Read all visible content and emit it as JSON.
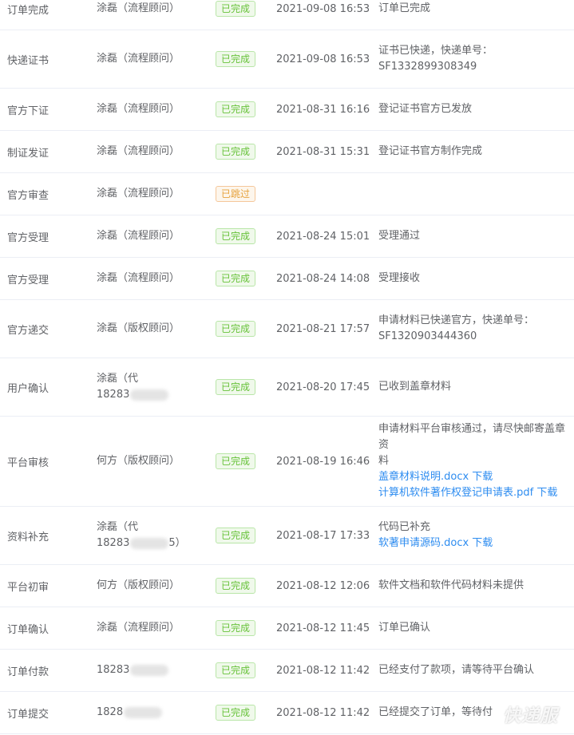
{
  "rows": [
    {
      "stage": "订单完成",
      "operator": "涂磊（流程顾问）",
      "status": "已完成",
      "time": "2021-09-08 16:53",
      "remark": [
        "订单已完成"
      ]
    },
    {
      "stage": "快递证书",
      "operator": "涂磊（流程顾问）",
      "status": "已完成",
      "time": "2021-09-08 16:53",
      "remark": [
        "证书已快递，快递单号：",
        "SF1332899308349"
      ]
    },
    {
      "stage": "官方下证",
      "operator": "涂磊（流程顾问）",
      "status": "已完成",
      "time": "2021-08-31 16:16",
      "remark": [
        "登记证书官方已发放"
      ]
    },
    {
      "stage": "制证发证",
      "operator": "涂磊（流程顾问）",
      "status": "已完成",
      "time": "2021-08-31 15:31",
      "remark": [
        "登记证书官方制作完成"
      ]
    },
    {
      "stage": "官方审查",
      "operator": "涂磊（流程顾问）",
      "status": "已跳过",
      "time": "",
      "remark": []
    },
    {
      "stage": "官方受理",
      "operator": "涂磊（流程顾问）",
      "status": "已完成",
      "time": "2021-08-24 15:01",
      "remark": [
        "受理通过"
      ]
    },
    {
      "stage": "官方受理",
      "operator": "涂磊（流程顾问）",
      "status": "已完成",
      "time": "2021-08-24 14:08",
      "remark": [
        "受理接收"
      ]
    },
    {
      "stage": "官方递交",
      "operator": "涂磊（版权顾问）",
      "status": "已完成",
      "time": "2021-08-21 17:57",
      "remark": [
        "申请材料已快递官方，快递单号：",
        "SF1320903444360"
      ]
    },
    {
      "stage": "用户确认",
      "operator": "涂磊（代",
      "operator2": "18283",
      "status": "已完成",
      "time": "2021-08-20 17:45",
      "remark": [
        "已收到盖章材料"
      ]
    },
    {
      "stage": "平台审核",
      "operator": "何方（版权顾问）",
      "status": "已完成",
      "time": "2021-08-19 16:46",
      "remark": [
        "申请材料平台审核通过，请尽快邮寄盖章资",
        "料"
      ],
      "links": [
        "盖章材料说明.docx 下载",
        "计算机软件著作权登记申请表.pdf 下载"
      ]
    },
    {
      "stage": "资料补充",
      "operator": "涂磊（代",
      "operator2": "18283",
      "operator2_tail": "5）",
      "status": "已完成",
      "time": "2021-08-17 17:33",
      "remark": [
        "代码已补充"
      ],
      "links": [
        "软著申请源码.docx 下载"
      ]
    },
    {
      "stage": "平台初审",
      "operator": "何方（版权顾问）",
      "status": "已完成",
      "time": "2021-08-12 12:06",
      "remark": [
        "软件文档和软件代码材料未提供"
      ]
    },
    {
      "stage": "订单确认",
      "operator": "涂磊（流程顾问）",
      "status": "已完成",
      "time": "2021-08-12 11:45",
      "remark": [
        "订单已确认"
      ]
    },
    {
      "stage": "订单付款",
      "operator": "18283",
      "status": "已完成",
      "time": "2021-08-12 11:42",
      "remark": [
        "已经支付了款项，请等待平台确认"
      ]
    },
    {
      "stage": "订单提交",
      "operator": "1828",
      "status": "已完成",
      "time": "2021-08-12 11:42",
      "remark": [
        "已经提交了订单，等待付"
      ]
    }
  ],
  "watermark": "快递服"
}
